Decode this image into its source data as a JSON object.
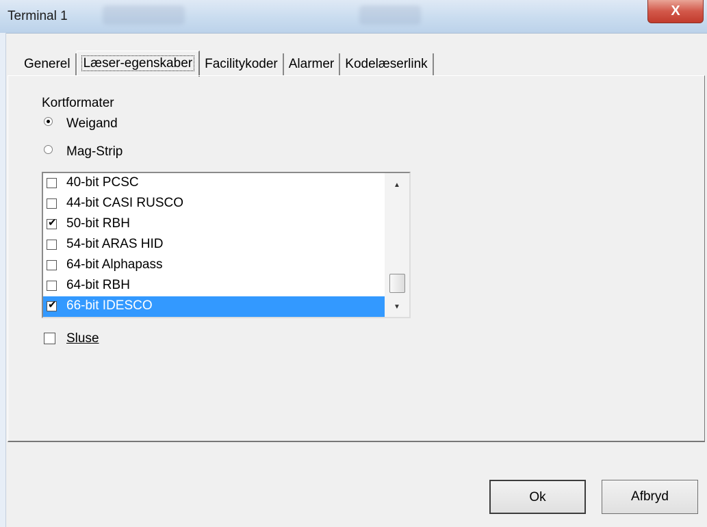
{
  "window": {
    "title": "Terminal 1",
    "close_label": "X"
  },
  "tabs": [
    {
      "label": "Generel"
    },
    {
      "label": "Læser-egenskaber"
    },
    {
      "label": "Facilitykoder"
    },
    {
      "label": "Alarmer"
    },
    {
      "label": "Kodelæserlink"
    }
  ],
  "card_formats": {
    "group_label": "Kortformater",
    "options": [
      {
        "label": "Weigand",
        "selected": true
      },
      {
        "label": "Mag-Strip",
        "selected": false
      }
    ]
  },
  "format_list": {
    "items": [
      {
        "label": "40-bit PCSC",
        "checked": false
      },
      {
        "label": "44-bit CASI RUSCO",
        "checked": false
      },
      {
        "label": "50-bit RBH",
        "checked": true
      },
      {
        "label": "54-bit ARAS HID",
        "checked": false
      },
      {
        "label": "64-bit Alphapass",
        "checked": false
      },
      {
        "label": "64-bit RBH",
        "checked": false
      },
      {
        "label": "66-bit IDESCO",
        "checked": true,
        "highlighted": true
      }
    ]
  },
  "sluse": {
    "label": "Sluse",
    "checked": false
  },
  "buttons": {
    "ok": "Ok",
    "cancel": "Afbryd"
  }
}
